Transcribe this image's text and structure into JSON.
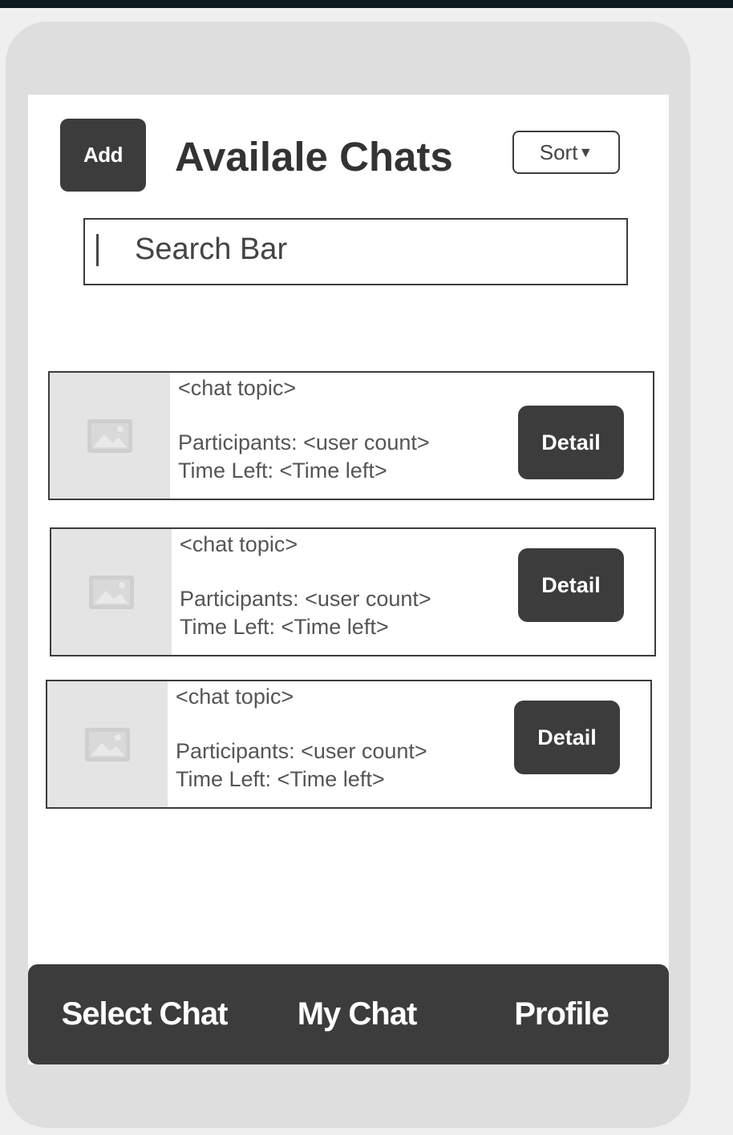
{
  "header": {
    "add_label": "Add",
    "title": "Availale Chats",
    "sort_label": "Sort",
    "sort_caret": "▼"
  },
  "search": {
    "placeholder": "Search Bar"
  },
  "chats": [
    {
      "topic": "<chat topic>",
      "participants": "Participants: <user count>",
      "time_left": "Time Left: <Time left>",
      "detail_label": "Detail"
    },
    {
      "topic": "<chat topic>",
      "participants": "Participants: <user count>",
      "time_left": "Time Left: <Time left>",
      "detail_label": "Detail"
    },
    {
      "topic": "<chat topic>",
      "participants": "Participants: <user count>",
      "time_left": "Time Left: <Time left>",
      "detail_label": "Detail"
    }
  ],
  "bottom_nav": {
    "tabs": [
      {
        "label": "Select Chat"
      },
      {
        "label": "My Chat"
      },
      {
        "label": "Profile"
      }
    ]
  },
  "colors": {
    "dark": "#3c3c3c",
    "frame": "#dedede",
    "placeholder_image": "#e4e4e4"
  },
  "icons": {
    "thumbnail": "image-placeholder-icon",
    "sort": "caret-down-icon"
  }
}
